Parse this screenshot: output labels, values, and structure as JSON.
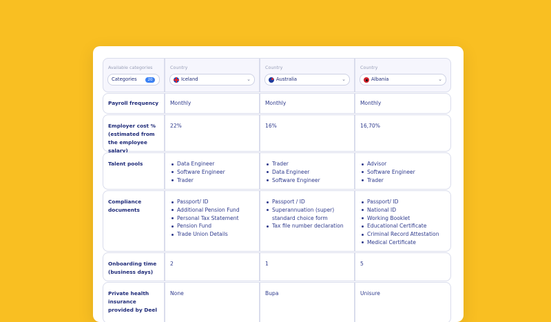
{
  "header": {
    "categories_label": "Available categories",
    "categories_select": "Categories",
    "categories_count": "20",
    "columns": [
      {
        "label": "Country",
        "value": "Iceland",
        "flag": "iceland-flag"
      },
      {
        "label": "Country",
        "value": "Australia",
        "flag": "australia-flag"
      },
      {
        "label": "Country",
        "value": "Albania",
        "flag": "albania-flag"
      }
    ]
  },
  "rows": [
    {
      "label": "Payroll frequency",
      "values": [
        "Monthly",
        "Monthly",
        "Monthly"
      ]
    },
    {
      "label": "Employer cost % (estimated from the employee salary)",
      "values": [
        "22%",
        "16%",
        "16,70%"
      ]
    },
    {
      "label": "Talent pools",
      "lists": [
        [
          "Data Engineer",
          "Software Engineer",
          "Trader"
        ],
        [
          "Trader",
          "Data Engineer",
          "Software Engineer"
        ],
        [
          "Advisor",
          "Software Engineer",
          "Trader"
        ]
      ]
    },
    {
      "label": "Compliance documents",
      "lists": [
        [
          "Passport/ ID",
          "Additional Pension Fund",
          "Personal Tax Statement",
          "Pension Fund",
          "Trade Union Details"
        ],
        [
          "Passport / ID",
          "Superannuation (super) standard choice form",
          "Tax file number declaration"
        ],
        [
          "Passport/ ID",
          "National ID",
          "Working Booklet",
          "Educational Certificate",
          "Criminal Record Attestation",
          "Medical Certificate"
        ]
      ]
    },
    {
      "label": "Onboarding time (business days)",
      "values": [
        "2",
        "1",
        "5"
      ]
    },
    {
      "label": "Private health insurance provided by Deel",
      "values": [
        "None",
        "Bupa",
        "Unisure"
      ]
    }
  ],
  "colors": {
    "background": "#F9BF22",
    "text": "#1E2A78",
    "badge": "#3B82F6"
  }
}
